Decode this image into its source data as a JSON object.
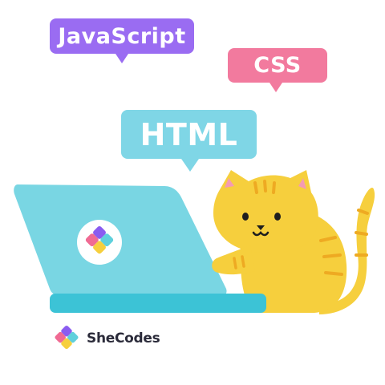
{
  "bubbles": {
    "javascript": {
      "label": "JavaScript",
      "color": "#9a6cf2"
    },
    "css": {
      "label": "CSS",
      "color": "#f27a9e"
    },
    "html": {
      "label": "HTML",
      "color": "#7fd6e6"
    }
  },
  "brand": {
    "name": "SheCodes"
  },
  "colors": {
    "laptop": "#79d6e3",
    "laptop_base": "#3cc3d6",
    "cat": "#f6cf3d",
    "cat_stripe": "#eeaa22",
    "cat_ear_inner": "#f49bb3",
    "logo_purple": "#8a5cf0",
    "logo_pink": "#f06a93",
    "logo_teal": "#5fd0dc",
    "logo_yellow": "#f6cf3d"
  }
}
